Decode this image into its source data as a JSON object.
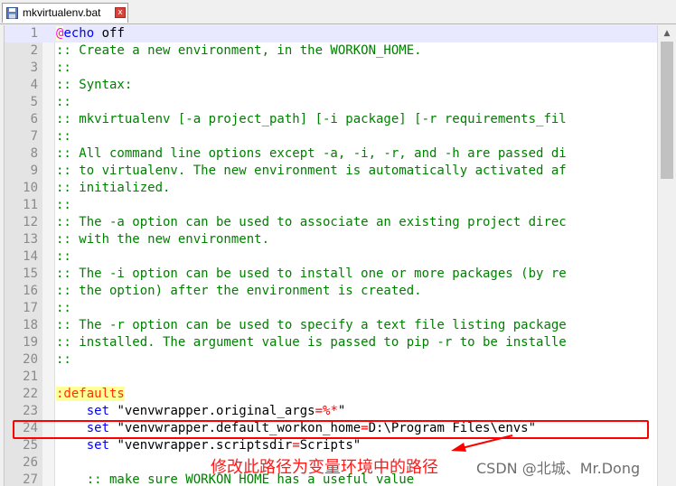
{
  "tab": {
    "title": "mkvirtualenv.bat",
    "close_label": "x"
  },
  "editor": {
    "lines": [
      {
        "n": "1",
        "parts": [
          {
            "t": "@",
            "c": "c-at"
          },
          {
            "t": "echo",
            "c": "c-kw"
          },
          {
            "t": " off",
            "c": ""
          }
        ]
      },
      {
        "n": "2",
        "parts": [
          {
            "t": ":: Create a new environment, in the WORKON_HOME.",
            "c": "c-comment"
          }
        ]
      },
      {
        "n": "3",
        "parts": [
          {
            "t": "::",
            "c": "c-comment"
          }
        ]
      },
      {
        "n": "4",
        "parts": [
          {
            "t": ":: Syntax:",
            "c": "c-comment"
          }
        ]
      },
      {
        "n": "5",
        "parts": [
          {
            "t": "::",
            "c": "c-comment"
          }
        ]
      },
      {
        "n": "6",
        "parts": [
          {
            "t": ":: mkvirtualenv [-a project_path] [-i package] [-r requirements_fil",
            "c": "c-comment"
          }
        ]
      },
      {
        "n": "7",
        "parts": [
          {
            "t": "::",
            "c": "c-comment"
          }
        ]
      },
      {
        "n": "8",
        "parts": [
          {
            "t": ":: All command line options except -a, -i, -r, and -h are passed di",
            "c": "c-comment"
          }
        ]
      },
      {
        "n": "9",
        "parts": [
          {
            "t": ":: to virtualenv. The new environment is automatically activated af",
            "c": "c-comment"
          }
        ]
      },
      {
        "n": "10",
        "parts": [
          {
            "t": ":: initialized.",
            "c": "c-comment"
          }
        ]
      },
      {
        "n": "11",
        "parts": [
          {
            "t": "::",
            "c": "c-comment"
          }
        ]
      },
      {
        "n": "12",
        "parts": [
          {
            "t": ":: The -a option can be used to associate an existing project direc",
            "c": "c-comment"
          }
        ]
      },
      {
        "n": "13",
        "parts": [
          {
            "t": ":: with the new environment.",
            "c": "c-comment"
          }
        ]
      },
      {
        "n": "14",
        "parts": [
          {
            "t": "::",
            "c": "c-comment"
          }
        ]
      },
      {
        "n": "15",
        "parts": [
          {
            "t": ":: The -i option can be used to install one or more packages (by re",
            "c": "c-comment"
          }
        ]
      },
      {
        "n": "16",
        "parts": [
          {
            "t": ":: the option) after the environment is created.",
            "c": "c-comment"
          }
        ]
      },
      {
        "n": "17",
        "parts": [
          {
            "t": "::",
            "c": "c-comment"
          }
        ]
      },
      {
        "n": "18",
        "parts": [
          {
            "t": ":: The -r option can be used to specify a text file listing package",
            "c": "c-comment"
          }
        ]
      },
      {
        "n": "19",
        "parts": [
          {
            "t": ":: installed. The argument value is passed to pip -r to be installe",
            "c": "c-comment"
          }
        ]
      },
      {
        "n": "20",
        "parts": [
          {
            "t": "::",
            "c": "c-comment"
          }
        ]
      },
      {
        "n": "21",
        "parts": []
      },
      {
        "n": "22",
        "parts": [
          {
            "t": ":defaults",
            "c": "c-label"
          }
        ]
      },
      {
        "n": "23",
        "parts": [
          {
            "t": "    ",
            "c": ""
          },
          {
            "t": "set",
            "c": "c-kw"
          },
          {
            "t": " \"venvwrapper.original_args",
            "c": ""
          },
          {
            "t": "=",
            "c": "c-op"
          },
          {
            "t": "%*",
            "c": "c-op"
          },
          {
            "t": "\"",
            "c": ""
          }
        ]
      },
      {
        "n": "24",
        "parts": [
          {
            "t": "    ",
            "c": ""
          },
          {
            "t": "set",
            "c": "c-kw"
          },
          {
            "t": " \"venvwrapper.default_workon_home",
            "c": ""
          },
          {
            "t": "=",
            "c": "c-op"
          },
          {
            "t": "D:\\Program Files\\envs\"",
            "c": ""
          }
        ]
      },
      {
        "n": "25",
        "parts": [
          {
            "t": "    ",
            "c": ""
          },
          {
            "t": "set",
            "c": "c-kw"
          },
          {
            "t": " \"venvwrapper.scriptsdir",
            "c": ""
          },
          {
            "t": "=",
            "c": "c-op"
          },
          {
            "t": "Scripts\"",
            "c": ""
          }
        ]
      },
      {
        "n": "26",
        "parts": []
      },
      {
        "n": "27",
        "parts": [
          {
            "t": "    :: make sure WORKON_HOME has a useful value",
            "c": "c-comment"
          }
        ]
      }
    ],
    "current_line": "1"
  },
  "annotation": {
    "text": "修改此路径为变量环境中的路径"
  },
  "watermark": {
    "text": "CSDN @北城、Mr.Dong"
  },
  "icons": {
    "file": "floppy-disk-icon",
    "close": "close-icon",
    "scroll_up": "chevron-up-icon"
  }
}
